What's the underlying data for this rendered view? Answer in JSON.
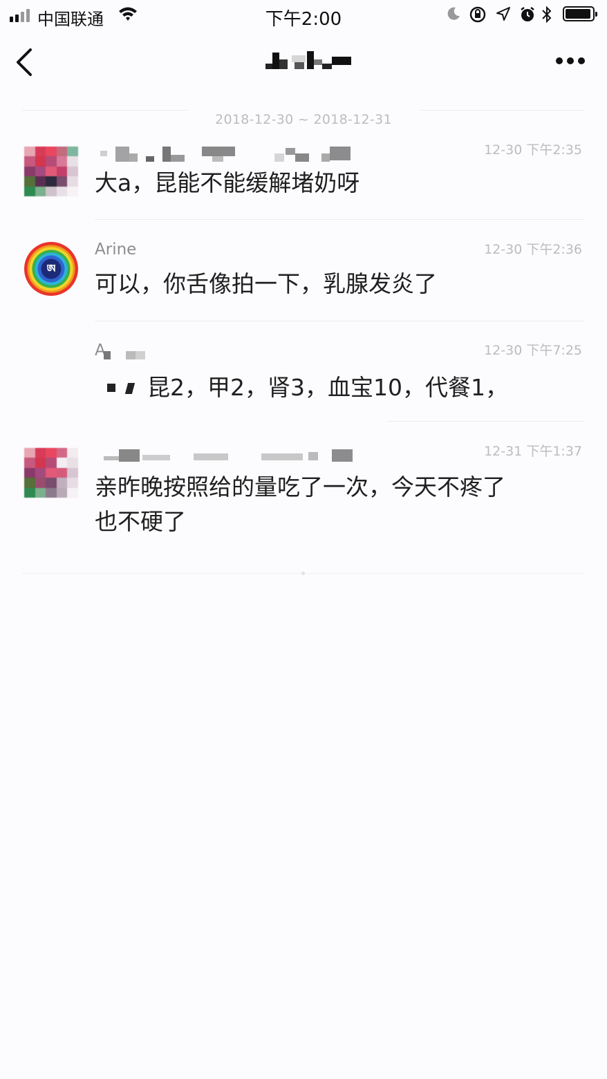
{
  "status_bar": {
    "carrier": "中国联通",
    "time": "下午2:00",
    "battery_level": 0.95
  },
  "nav": {
    "back_icon": "chevron-left-icon",
    "more_icon": "more-dots-icon"
  },
  "date_range": "2018-12-30 ~ 2018-12-31",
  "messages": [
    {
      "name": "",
      "time": "12-30 下午2:35",
      "text": "大a，昆能不能缓解堵奶呀"
    },
    {
      "name": "Arine",
      "time": "12-30 下午2:36",
      "text": "可以，你舌像拍一下，乳腺发炎了"
    },
    {
      "name": "A",
      "time": "12-30 下午7:25",
      "text": "昆2，甲2，肾3，血宝10，代餐1，"
    },
    {
      "name": "",
      "time": "12-31 下午1:37",
      "text_line1": "亲昨晚按照给的量吃了一次，今天不疼了",
      "text_line2": "也不硬了"
    }
  ],
  "avatar_glyph": "ཨ"
}
